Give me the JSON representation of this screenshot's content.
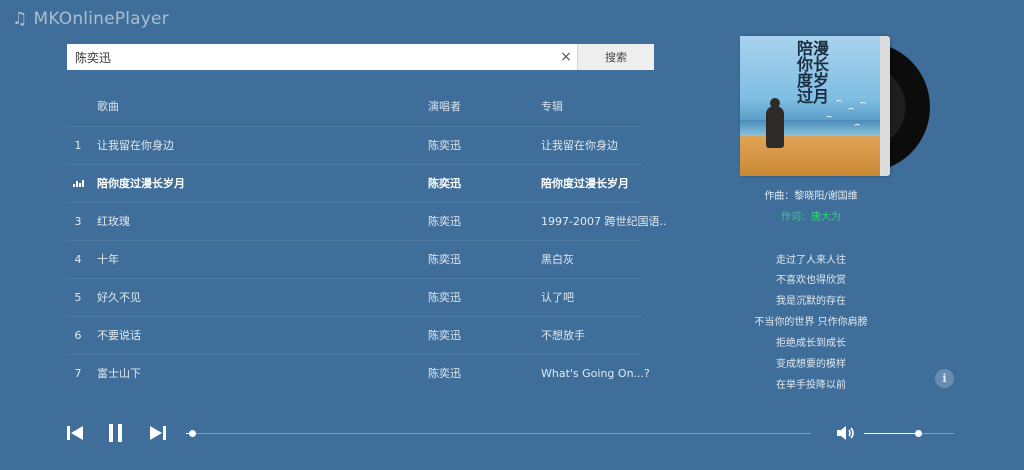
{
  "app": {
    "title": "MKOnlinePlayer",
    "logo_icon": "music-note-icon"
  },
  "search": {
    "value": "陈奕迅",
    "placeholder": "",
    "clear_label": "×",
    "button_label": "搜索"
  },
  "list": {
    "headers": {
      "title": "歌曲",
      "artist": "演唱者",
      "album": "专辑"
    },
    "playing_index": 1,
    "tracks": [
      {
        "num": "1",
        "title": "让我留在你身边",
        "artist": "陈奕迅",
        "album": "让我留在你身边"
      },
      {
        "num": "",
        "title": "陪你度过漫长岁月",
        "artist": "陈奕迅",
        "album": "陪你度过漫长岁月"
      },
      {
        "num": "3",
        "title": "红玫瑰",
        "artist": "陈奕迅",
        "album": "1997-2007 跨世纪国语.."
      },
      {
        "num": "4",
        "title": "十年",
        "artist": "陈奕迅",
        "album": "黑白灰"
      },
      {
        "num": "5",
        "title": "好久不见",
        "artist": "陈奕迅",
        "album": "认了吧"
      },
      {
        "num": "6",
        "title": "不要说话",
        "artist": "陈奕迅",
        "album": "不想放手"
      },
      {
        "num": "7",
        "title": "富士山下",
        "artist": "陈奕迅",
        "album": "What's Going On...?"
      }
    ]
  },
  "now_playing": {
    "cover_text_right": "漫长岁月",
    "cover_text_left": "陪你度过",
    "composer": "作曲：黎晓阳/谢国维",
    "lyricist": "作词：唐大为",
    "lyricist_color": "#2ed573",
    "lyrics": [
      "走过了人来人往",
      "不喜欢也得欣赏",
      "我是沉默的存在",
      "不当你的世界 只作你肩膀",
      "拒绝成长到成长",
      "变成想要的模样",
      "在举手投降以前"
    ],
    "info_label": "i"
  },
  "player": {
    "progress": 0.01,
    "volume": 0.6,
    "prev_icon": "skip-previous-icon",
    "pause_icon": "pause-icon",
    "next_icon": "skip-next-icon",
    "volume_icon": "volume-icon"
  },
  "theme": {
    "background": "#3f6e9a",
    "accent_green": "#2ed573"
  }
}
